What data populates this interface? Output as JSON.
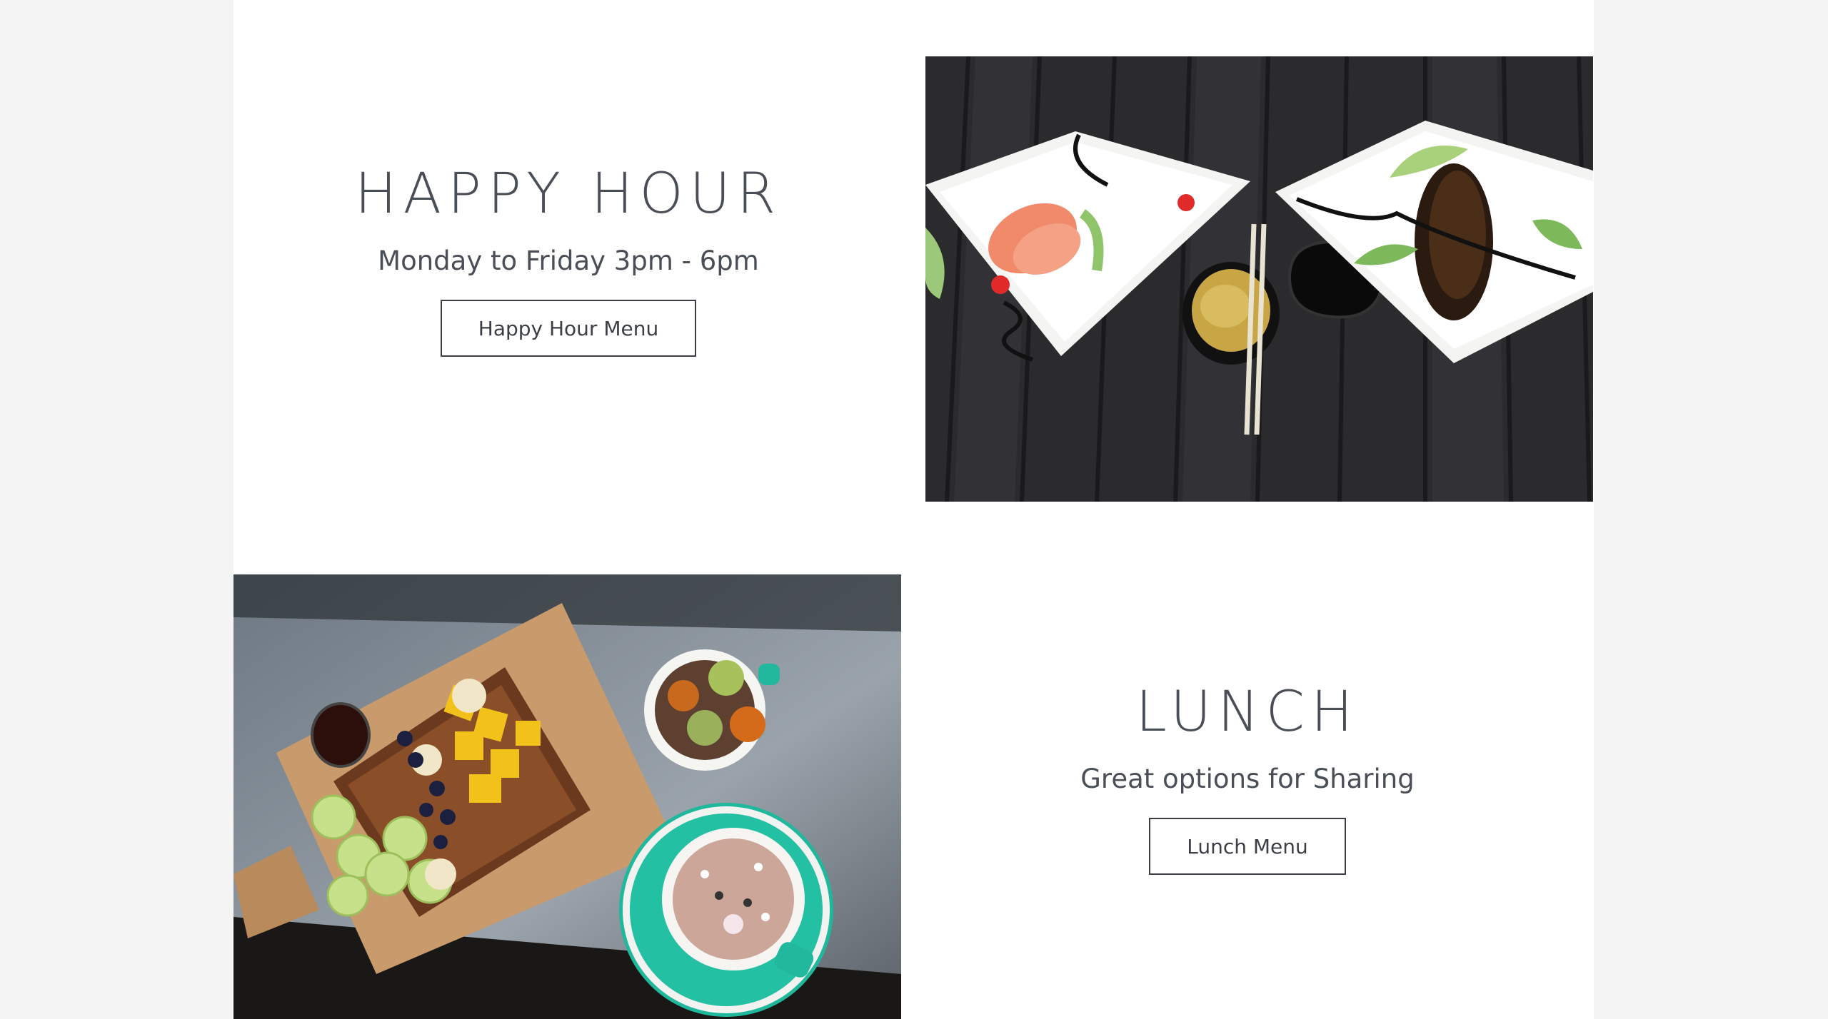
{
  "happy_hour": {
    "title": "HAPPY HOUR",
    "subtitle": "Monday to Friday 3pm - 6pm",
    "button_label": "Happy Hour Menu"
  },
  "lunch": {
    "title": "LUNCH",
    "subtitle": "Great options for Sharing",
    "button_label": "Lunch Menu"
  },
  "colors": {
    "page_background": "#f4f4f4",
    "content_background": "#ffffff",
    "text": "#4a4f57",
    "button_border": "#3b3f45"
  },
  "images": {
    "happy_hour_photo": "sushi-sashimi-plates-photo",
    "lunch_photo": "french-toast-fruit-board-photo"
  }
}
